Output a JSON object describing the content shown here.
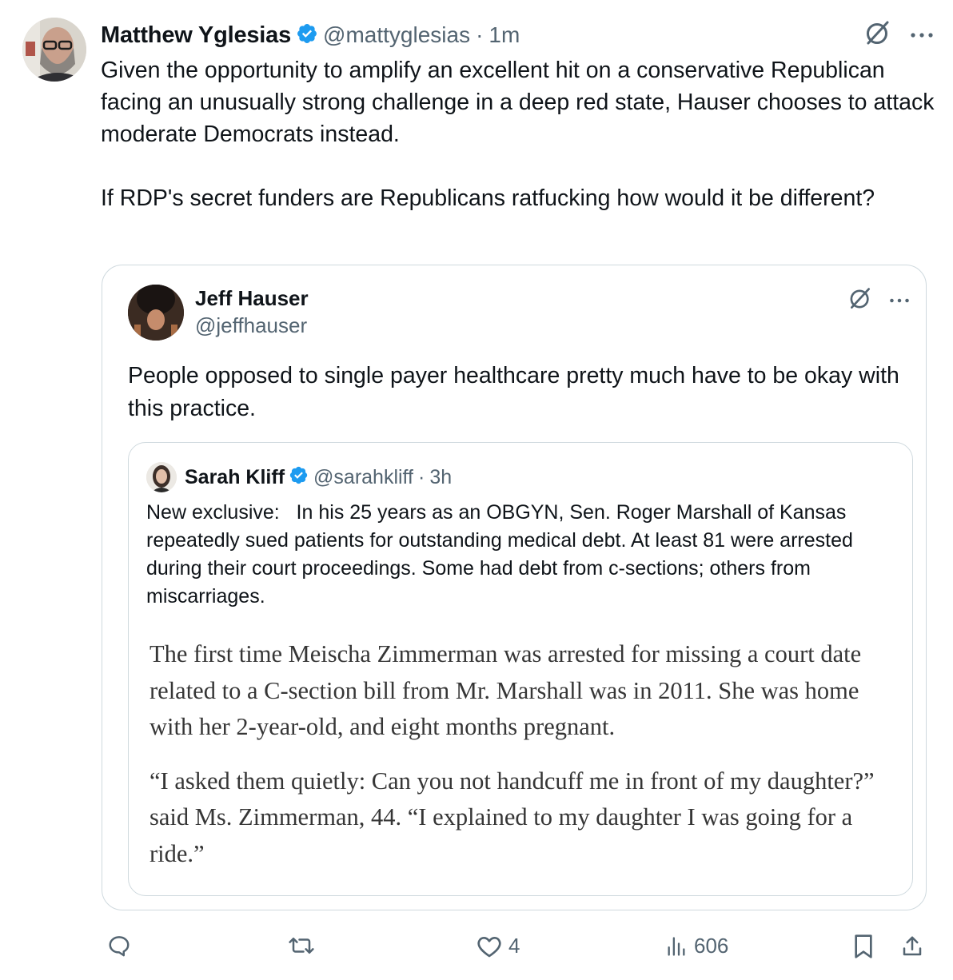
{
  "tweet": {
    "author_name": "Matthew Yglesias",
    "handle": "@mattyglesias",
    "separator": "·",
    "time": "1m",
    "text": "Given the opportunity to amplify an excellent hit on a conservative Republican facing an unusually strong challenge in a deep red state, Hauser chooses to attack moderate Democrats instead.\n\nIf RDP's secret funders are Republicans ratfucking how would it be different?",
    "verified": true
  },
  "quoted": {
    "author_name": "Jeff Hauser",
    "handle": "@jeffhauser",
    "text": "People opposed to single payer healthcare pretty much have to be okay with this practice."
  },
  "nested": {
    "author_name": "Sarah Kliff",
    "handle": "@sarahkliff",
    "separator": "·",
    "time": "3h",
    "verified": true,
    "text": "New exclusive:   In his 25 years as an OBGYN, Sen. Roger Marshall of Kansas repeatedly sued patients for outstanding medical debt. At least 81 were arrested during their court proceedings. Some had debt from c-sections; others from miscarriages.",
    "article_paragraphs": [
      "The first time Meischa Zimmerman was arrested for missing a court date related to a C-section bill from Mr. Marshall was in 2011. She was home with her 2-year-old, and eight months pregnant.",
      "“I asked them quietly: Can you not handcuff me in front of my daughter?” said Ms. Zimmerman, 44. “I explained to my daughter I was going for a ride.”"
    ]
  },
  "actions": {
    "reply_count": "",
    "retweet_count": "",
    "like_count": "4",
    "views_count": "606"
  },
  "colors": {
    "verified_blue": "#1d9bf0",
    "secondary_text": "#536471",
    "border": "#cfd9de"
  },
  "icons": [
    "grok-icon",
    "more-icon",
    "verified-badge-icon",
    "reply-icon",
    "retweet-icon",
    "like-icon",
    "views-icon",
    "bookmark-icon",
    "share-icon"
  ]
}
